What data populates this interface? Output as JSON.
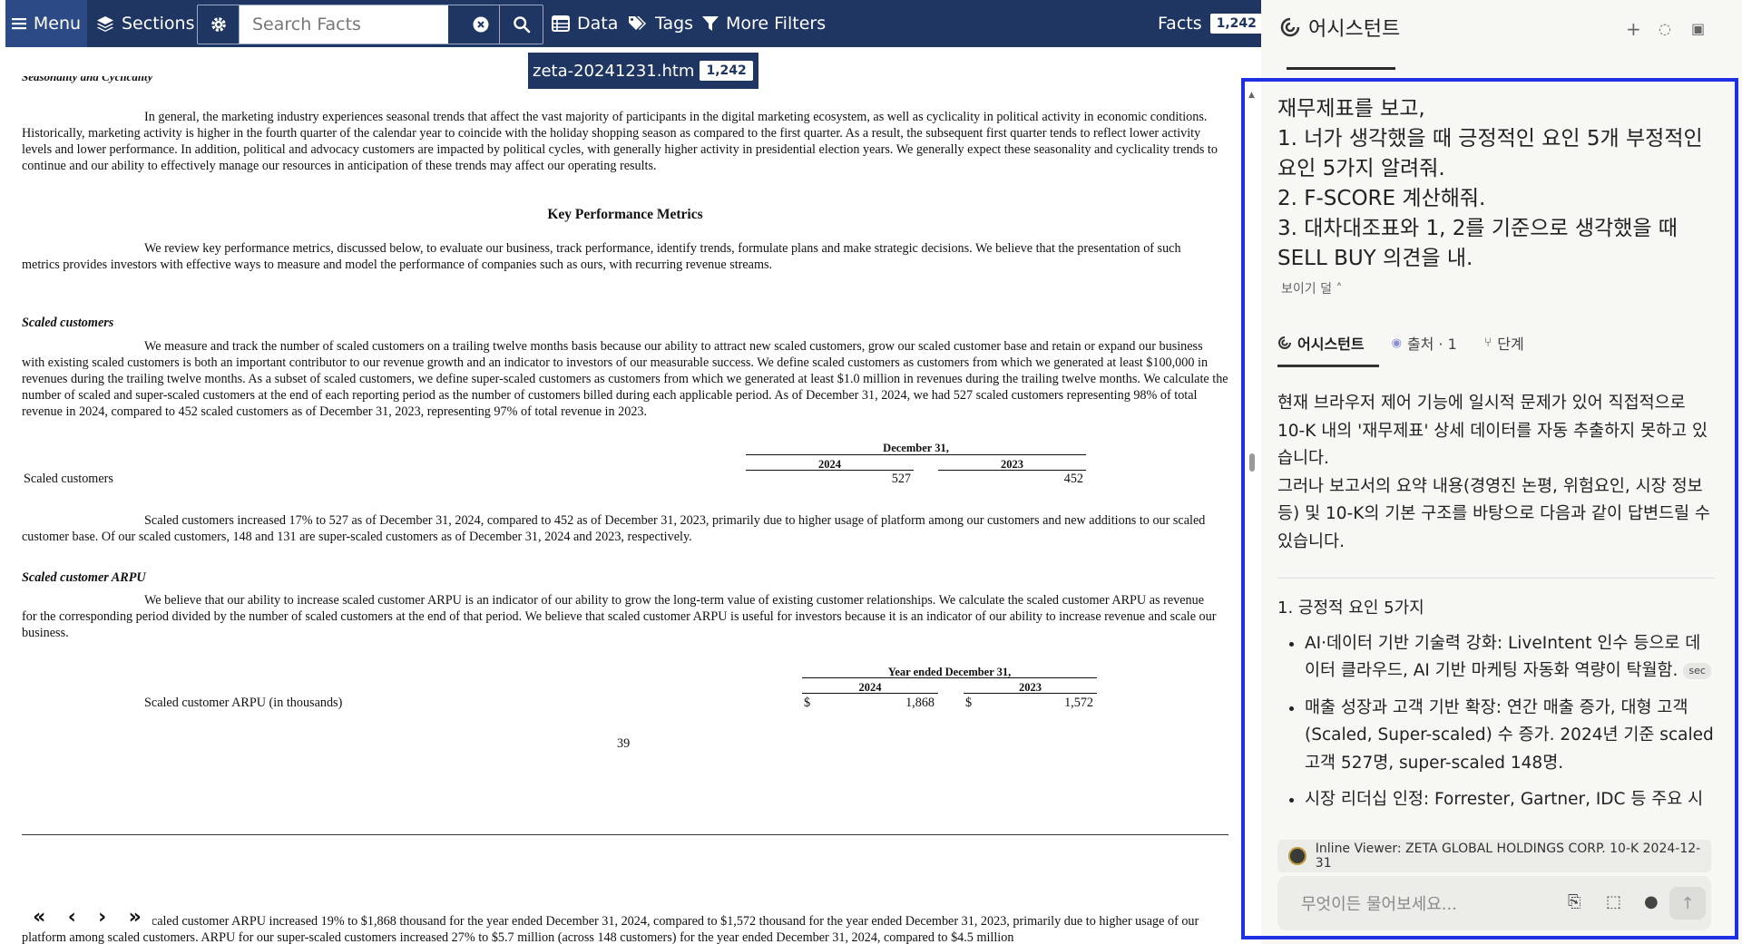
{
  "toolbar": {
    "menu_label": "Menu",
    "sections_label": "Sections",
    "search_placeholder": "Search Facts",
    "data_label": "Data",
    "tags_label": "Tags",
    "more_filters_label": "More Filters",
    "facts_label": "Facts",
    "facts_count": "1,242"
  },
  "file_tab": {
    "name": "zeta-20241231.htm",
    "count": "1,242"
  },
  "document": {
    "cut_heading": "Seasonality and Cyclicality",
    "seasonality_para": "In general, the marketing industry experiences seasonal trends that affect the vast majority of participants in the digital marketing ecosystem, as well as cyclicality in political activity in economic conditions. Historically, marketing activity is higher in the fourth quarter of the calendar year to coincide with the holiday shopping season as compared to the first quarter. As a result, the subsequent first quarter tends to reflect lower activity levels and lower performance. In addition, political and advocacy customers are impacted by political cycles, with generally higher activity in presidential election years. We generally expect these seasonality and cyclicality trends to continue and our ability to effectively manage our resources in anticipation of these trends may affect our operating results.",
    "kpm_heading": "Key Performance Metrics",
    "kpm_para": "We review key performance metrics, discussed below, to evaluate our business, track performance, identify trends, formulate plans and make strategic decisions. We believe that the presentation of such metrics provides investors with effective ways to measure and model the performance of companies such as ours, with recurring revenue streams.",
    "scaled_heading": "Scaled customers",
    "scaled_para": "We measure and track the number of scaled customers on a trailing twelve months basis because our ability to attract new scaled customers, grow our scaled customer base and retain or expand our business with existing scaled customers is both an important contributor to our revenue growth and an indicator to investors of our measurable success. We define scaled customers as customers from which we generated at least $100,000 in revenues during the trailing twelve months. As a subset of scaled customers, we define super-scaled customers as customers from which we generated at least $1.0 million in revenues during the trailing twelve months. We calculate the number of scaled and super-scaled customers at the end of each reporting period as the number of customers billed during each applicable period. As of December 31, 2024, we had 527 scaled customers representing 98% of total revenue in 2024, compared to 452 scaled customers as of December 31, 2023, representing 97% of total revenue in 2023.",
    "table1": {
      "header": "December 31,",
      "col1": "2024",
      "col2": "2023",
      "row_label": "Scaled customers",
      "v1": "527",
      "v2": "452"
    },
    "scaled_increase_para": "Scaled customers increased 17% to 527 as of December 31, 2024, compared to 452 as of December 31, 2023, primarily due to higher usage of platform among our customers and new additions to our scaled customer base. Of our scaled customers, 148 and 131 are super-scaled customers as of December 31, 2024 and 2023, respectively.",
    "arpu_heading": "Scaled customer ARPU",
    "arpu_para": "We believe that our ability to increase scaled customer ARPU is an indicator of our ability to grow the long-term value of existing customer relationships. We calculate the scaled customer ARPU as revenue for the corresponding period divided by the number of scaled customers at the end of that period. We believe that scaled customer ARPU is useful for investors because it is an indicator of our ability to increase revenue and scale our business.",
    "table2": {
      "header": "Year ended December 31,",
      "col1": "2024",
      "col2": "2023",
      "row_label": "Scaled customer ARPU (in thousands)",
      "cur": "$",
      "v1": "1,868",
      "v2": "1,572"
    },
    "page_number": "39",
    "bottom_para": "Scaled customer ARPU increased 19% to $1,868 thousand for the year ended December 31, 2024, compared to $1,572 thousand for the year ended December 31, 2023, primarily due to higher usage of our platform among scaled customers. ARPU for our super-scaled customers increased 27% to $5.7 million (across 148 customers) for the year ended December 31, 2024, compared to $4.5 million"
  },
  "assistant": {
    "title": "어시스턴트",
    "question_line1": "재무제표를 보고,",
    "question_line2": "1. 너가 생각했을 때 긍정적인 요인 5개 부정적인 요인 5가지 알려줘.",
    "question_line3": "2. F-SCORE 계산해줘.",
    "question_line4": "3. 대차대조표와 1, 2를 기준으로 생각했을 때 SELL BUY 의견을 내.",
    "show_less": "보이기 덜",
    "tabs": {
      "assistant": "어시스턴트",
      "sources": "출처 · 1",
      "steps": "단계"
    },
    "answer_p1": "현재 브라우저 제어 기능에 일시적 문제가 있어 직접적으로 10-K 내의 '재무제표' 상세 데이터를 자동 추출하지 못하고 있습니다.",
    "answer_p2": "그러나 보고서의 요약 내용(경영진 논평, 위험요인, 시장 정보 등) 및 10-K의 기본 구조를 바탕으로 다음과 같이 답변드릴 수 있습니다.",
    "section1_heading": "1. 긍정적 요인 5가지",
    "bullets": [
      {
        "lead": "AI·데이터 기반 기술력 강화",
        "text": ": LiveIntent 인수 등으로 데이터 클라우드, AI 기반 마케팅 자동화 역량이 탁월함.",
        "chip": "sec"
      },
      {
        "lead": "매출 성장과 고객 기반 확장",
        "text": ": 연간 매출 증가, 대형 고객(Scaled, Super-scaled) 수 증가. 2024년 기준 scaled 고객 527명, super-scaled 148명.",
        "chip": ""
      },
      {
        "lead": "시장 리더십 인정",
        "text": ": Forrester, Gartner, IDC 등 주요 시",
        "chip": ""
      }
    ],
    "inline_viewer": "Inline Viewer: ZETA GLOBAL HOLDINGS CORP. 10-K 2024-12-31",
    "composer_placeholder": "무엇이든 물어보세요..."
  }
}
